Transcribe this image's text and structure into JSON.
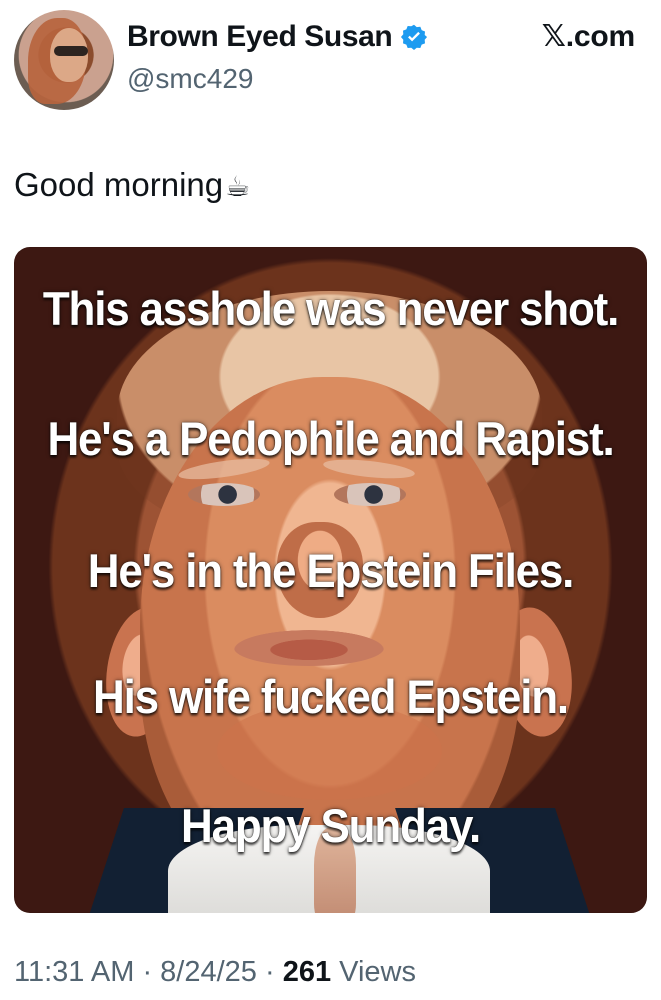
{
  "tweet": {
    "display_name": "Brown Eyed Susan",
    "handle": "@smc429",
    "brand": "𝕏.com",
    "text": "Good morning",
    "emoji": "☕",
    "icons": {
      "verified": "verified-badge-icon",
      "avatar": "profile-avatar",
      "coffee": "coffee-cup-icon"
    }
  },
  "media": {
    "lines": [
      "This asshole was never shot.",
      "He's a Pedophile and Rapist.",
      "He's in the Epstein Files.",
      "His wife fucked Epstein.",
      "Happy Sunday."
    ]
  },
  "footer": {
    "time": "11:31 AM",
    "separator1": " · ",
    "date": "8/24/25",
    "separator2": " · ",
    "views_count": "261",
    "views_label": " Views"
  },
  "colors": {
    "text_primary": "#0f1419",
    "text_secondary": "#536471",
    "verified_blue": "#1d9bf0"
  }
}
